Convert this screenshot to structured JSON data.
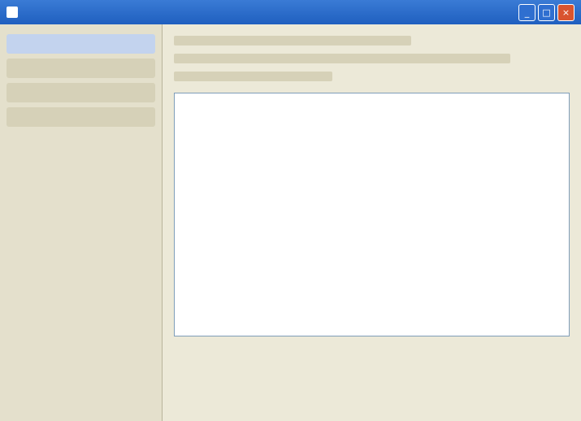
{
  "window": {
    "title": "",
    "controls": {
      "minimize": "_",
      "maximize": "□",
      "close": "×"
    }
  }
}
